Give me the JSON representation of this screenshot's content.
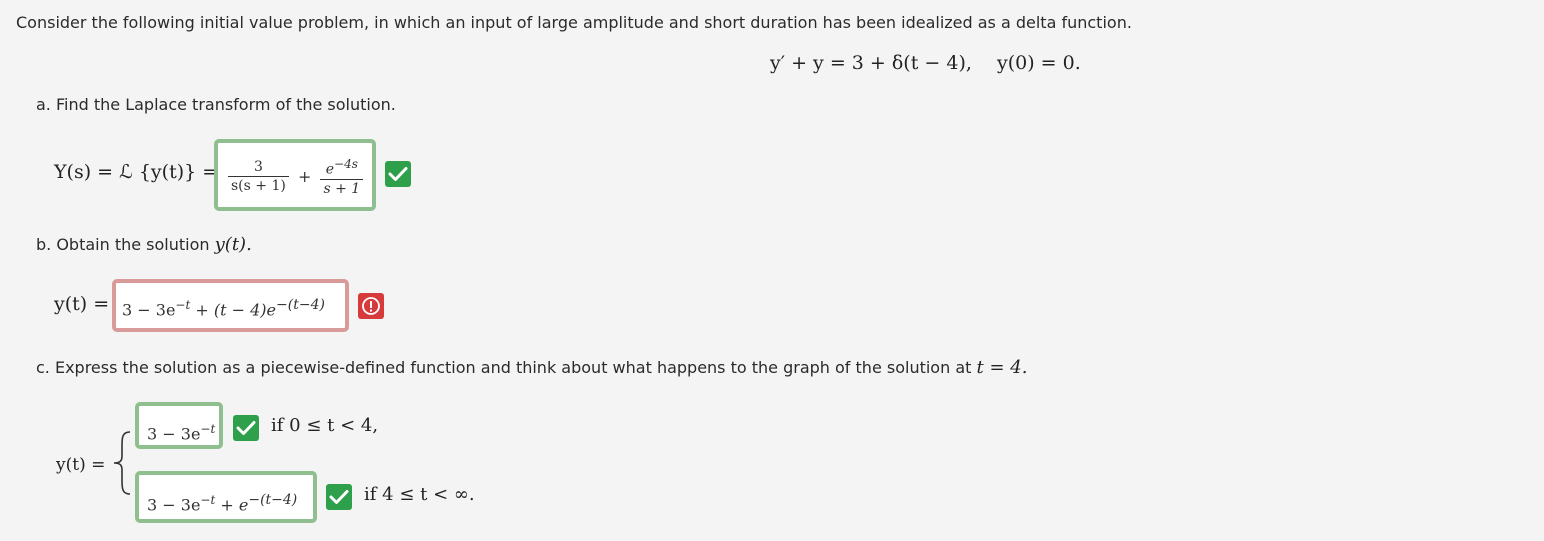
{
  "problem": {
    "intro": "Consider the following initial value problem, in which an input of large amplitude and short duration has been idealized as a delta function.",
    "equation": "y′ + y = 3 + δ(t − 4),",
    "initial_condition": "y(0) = 0."
  },
  "part_a": {
    "prompt": "a. Find the Laplace transform of the solution.",
    "lhs": "Y(s) = ℒ {y(t)} =",
    "answer": {
      "term1_num": "3",
      "term1_den": "s(s + 1)",
      "plus": "+",
      "term2_num": "e",
      "term2_num_exp": "−4s",
      "term2_den": "s + 1"
    },
    "status": "correct",
    "status_icon": "check-icon"
  },
  "part_b": {
    "prompt_text": "b. Obtain the solution ",
    "prompt_math": "y(t).",
    "lhs": "y(t) =",
    "answer": {
      "a": "3 − 3e",
      "a_exp": "−t",
      "b": " + (t − 4)e",
      "b_exp": "−(t−4)"
    },
    "status": "incorrect",
    "status_icon": "exclamation-icon"
  },
  "part_c": {
    "prompt_text": "c. Express the solution as a piecewise-defined function and think about what happens to the graph of the solution at ",
    "prompt_math": "t = 4.",
    "lhs": "y(t) =",
    "piece1": {
      "answer_base": "3 − 3e",
      "answer_exp": "−t",
      "condition": "if  0 ≤ t < 4,",
      "status": "correct"
    },
    "piece2": {
      "answer_base": "3 − 3e",
      "answer_exp": "−t",
      "answer_mid": " + e",
      "answer_exp2": "−(t−4)",
      "condition": "if  4 ≤ t < ∞.",
      "status": "correct"
    }
  },
  "colors": {
    "correct_border": "#8fbf8f",
    "correct_badge": "#2e9f4a",
    "incorrect_border": "#d99a9a",
    "incorrect_badge": "#d63a3a",
    "background": "#f4f4f4"
  }
}
